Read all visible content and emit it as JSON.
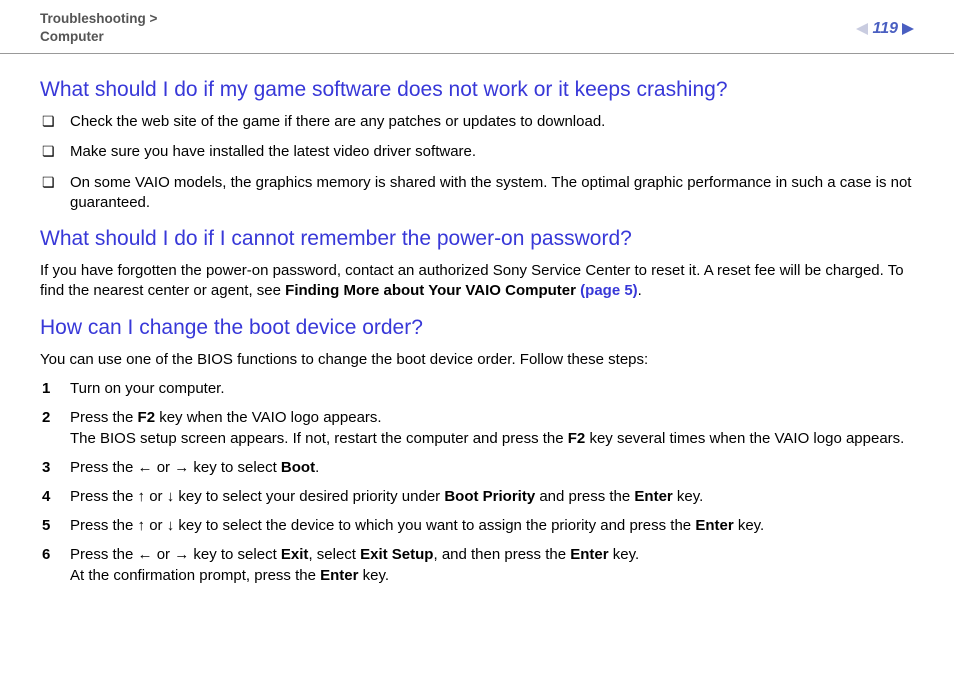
{
  "header": {
    "breadcrumb_line1": "Troubleshooting >",
    "breadcrumb_line2": "Computer",
    "page_number": "119"
  },
  "section1": {
    "heading": "What should I do if my game software does not work or it keeps crashing?",
    "bullets": [
      "Check the web site of the game if there are any patches or updates to download.",
      "Make sure you have installed the latest video driver software.",
      "On some VAIO models, the graphics memory is shared with the system. The optimal graphic performance in such a case is not guaranteed."
    ]
  },
  "section2": {
    "heading": "What should I do if I cannot remember the power-on password?",
    "para_pre": "If you have forgotten the power-on password, contact an authorized Sony Service Center to reset it. A reset fee will be charged. To find the nearest center or agent, see ",
    "para_bold": "Finding More about Your VAIO Computer ",
    "para_link": "(page 5)",
    "para_post": "."
  },
  "section3": {
    "heading": "How can I change the boot device order?",
    "intro": "You can use one of the BIOS functions to change the boot device order. Follow these steps:",
    "steps": {
      "s1": "Turn on your computer.",
      "s2a": "Press the ",
      "s2b": "F2",
      "s2c": " key when the VAIO logo appears.",
      "s2d": "The BIOS setup screen appears. If not, restart the computer and press the ",
      "s2e": "F2",
      "s2f": " key several times when the VAIO logo appears.",
      "s3a": "Press the ← or → key to select ",
      "s3b": "Boot",
      "s3c": ".",
      "s4a": "Press the ↑ or ↓ key to select your desired priority under ",
      "s4b": "Boot Priority",
      "s4c": " and press the ",
      "s4d": "Enter",
      "s4e": " key.",
      "s5a": "Press the ↑ or ↓ key to select the device to which you want to assign the priority and press the ",
      "s5b": "Enter",
      "s5c": " key.",
      "s6a": "Press the ← or → key to select ",
      "s6b": "Exit",
      "s6c": ", select ",
      "s6d": "Exit Setup",
      "s6e": ", and then press the ",
      "s6f": "Enter",
      "s6g": " key.",
      "s6h": "At the confirmation prompt, press the ",
      "s6i": "Enter",
      "s6j": " key."
    }
  }
}
